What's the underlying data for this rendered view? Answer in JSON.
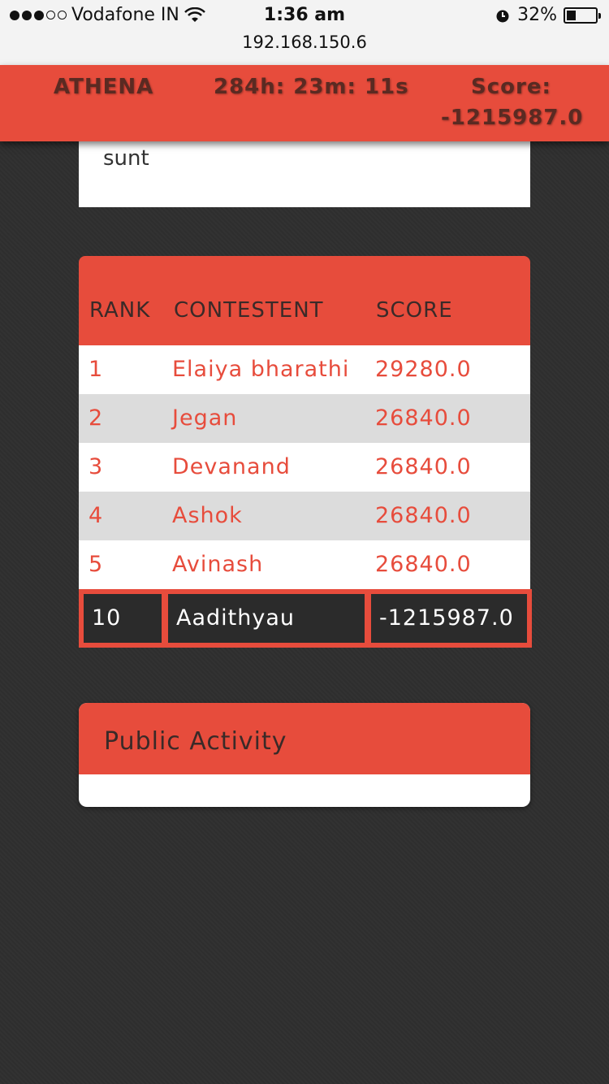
{
  "status_bar": {
    "carrier": "Vodafone IN",
    "time": "1:36 am",
    "url": "192.168.150.6",
    "battery": "32%",
    "battery_level": 0.32,
    "signal_bars_filled": 3,
    "signal_bars_total": 5
  },
  "header": {
    "brand": "ATHENA",
    "timer": "284h: 23m: 11s",
    "score_label": "Score:",
    "score_value": "-1215987.0"
  },
  "top_card": {
    "text": "sunt"
  },
  "leaderboard": {
    "columns": [
      "RANK",
      "CONTESTENT",
      "SCORE"
    ],
    "rows": [
      {
        "rank": "1",
        "name": "Elaiya bharathi",
        "score": "29280.0"
      },
      {
        "rank": "2",
        "name": "Jegan",
        "score": "26840.0"
      },
      {
        "rank": "3",
        "name": "Devanand",
        "score": "26840.0"
      },
      {
        "rank": "4",
        "name": "Ashok",
        "score": "26840.0"
      },
      {
        "rank": "5",
        "name": "Avinash",
        "score": "26840.0"
      }
    ],
    "current_user": {
      "rank": "10",
      "name": "Aadithyau",
      "score": "-1215987.0"
    }
  },
  "activity": {
    "title": "Public Activity"
  },
  "colors": {
    "accent": "#e74c3c",
    "background": "#2f2f2f",
    "row_alt": "#dcdcdc"
  }
}
